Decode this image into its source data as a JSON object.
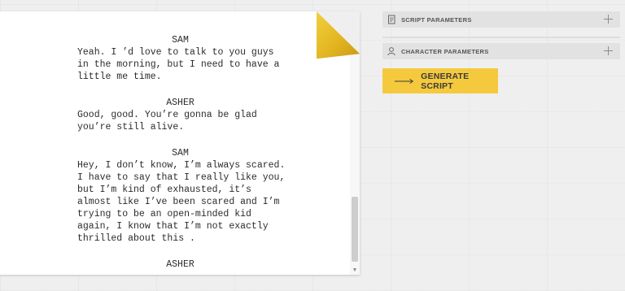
{
  "script_page": {
    "blocks": [
      {
        "speaker": "SAM",
        "lines": [
          "Yeah. I ’d love to talk to you guys",
          "in the morning, but I need to have a",
          "little me time."
        ]
      },
      {
        "speaker": "ASHER",
        "lines": [
          "Good, good. You’re gonna be glad",
          "you’re still alive."
        ]
      },
      {
        "speaker": "SAM",
        "lines": [
          "Hey, I don’t know, I’m always scared.",
          "I have to say that I really like you,",
          "but I’m kind of exhausted, it’s",
          "almost like I’ve been scared and I’m",
          "trying to be an open-minded kid",
          "again, I know that I’m not exactly",
          "thrilled about this ."
        ]
      },
      {
        "speaker": "ASHER",
        "lines": []
      }
    ]
  },
  "panel": {
    "script_parameters_label": "SCRIPT PARAMETERS",
    "character_parameters_label": "CHARACTER PARAMETERS",
    "generate_label": "GENERATE SCRIPT"
  },
  "colors": {
    "accent": "#f5c93e",
    "fold_gold": "#e8bf2a"
  },
  "icons": {
    "script_parameters": "script-icon",
    "character_parameters": "person-icon",
    "expand": "plus-icon",
    "generate": "arrow-right-icon"
  }
}
